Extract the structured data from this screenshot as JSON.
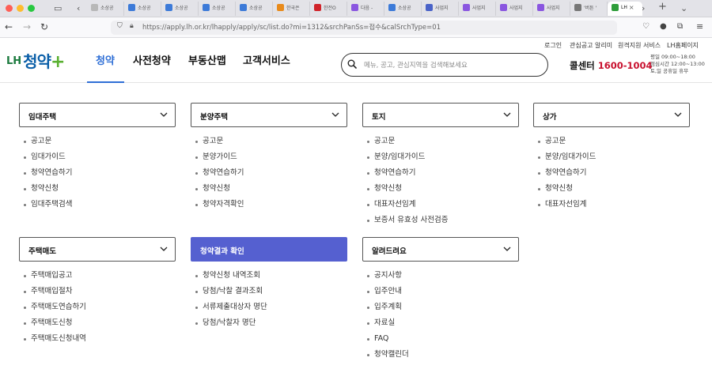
{
  "browser": {
    "tabs": [
      {
        "label": "소상공",
        "color": "#b8b8b8"
      },
      {
        "label": "소상공",
        "color": "#3c7ad8"
      },
      {
        "label": "소상공",
        "color": "#3c7ad8"
      },
      {
        "label": "소상공",
        "color": "#3c7ad8"
      },
      {
        "label": "소상공",
        "color": "#3c7ad8"
      },
      {
        "label": "한국은",
        "color": "#e88a1a"
      },
      {
        "label": "한전O",
        "color": "#d0232a"
      },
      {
        "label": "다음 -",
        "color": "#8a56e0"
      },
      {
        "label": "소상공",
        "color": "#3c7ad8"
      },
      {
        "label": "사업지",
        "color": "#4a63c8"
      },
      {
        "label": "사업지",
        "color": "#8a56e0"
      },
      {
        "label": "사업지",
        "color": "#8a56e0"
      },
      {
        "label": "사업지",
        "color": "#8a56e0"
      },
      {
        "label": "'버튼 '",
        "color": "#777777"
      }
    ],
    "active_tab": {
      "label": "LH",
      "color": "#2e9d3a"
    },
    "url": "https://apply.lh.or.kr/lhapply/apply/sc/list.do?mi=1312&srchPanSs=접수&calSrchType=01"
  },
  "header": {
    "logo_lh": "LH",
    "logo_text": "청약",
    "logo_plus": "+",
    "gnb": [
      "청약",
      "사전청약",
      "부동산맵",
      "고객서비스"
    ],
    "gnb_active": "청약",
    "util": [
      "로그인",
      "관심공고 알리미",
      "원격지원 서비스",
      "LH홈페이지"
    ],
    "search_placeholder": "메뉴, 공고, 관심지역을 검색해보세요",
    "callcenter_label": "콜센터",
    "callcenter_number": "1600-1004",
    "hours": [
      "평일 09:00~18:00",
      "점심시간 12:00~13:00",
      "토,일 공휴일 휴무"
    ]
  },
  "menus": [
    {
      "title": "임대주택",
      "active": false,
      "items": [
        "공고문",
        "임대가이드",
        "청약연습하기",
        "청약신청",
        "임대주택검색"
      ]
    },
    {
      "title": "분양주택",
      "active": false,
      "items": [
        "공고문",
        "분양가이드",
        "청약연습하기",
        "청약신청",
        "청약자격확인"
      ]
    },
    {
      "title": "토지",
      "active": false,
      "items": [
        "공고문",
        "분양/임대가이드",
        "청약연습하기",
        "청약신청",
        "대표자선임계",
        "보증서 유효성 사전검증"
      ]
    },
    {
      "title": "상가",
      "active": false,
      "items": [
        "공고문",
        "분양/임대가이드",
        "청약연습하기",
        "청약신청",
        "대표자선임계"
      ]
    },
    {
      "title": "주택매도",
      "active": false,
      "items": [
        "주택매입공고",
        "주택매입절차",
        "주택매도연습하기",
        "주택매도신청",
        "주택매도신청내역"
      ]
    },
    {
      "title": "청약결과 확인",
      "active": true,
      "items": [
        "청약신청 내역조회",
        "당첨/낙찰 결과조회",
        "서류제출대상자 명단",
        "당첨/낙찰자 명단"
      ]
    },
    {
      "title": "알려드려요",
      "active": false,
      "items": [
        "공지사항",
        "입주안내",
        "입주계획",
        "자료실",
        "FAQ",
        "청약캘린더"
      ]
    }
  ]
}
